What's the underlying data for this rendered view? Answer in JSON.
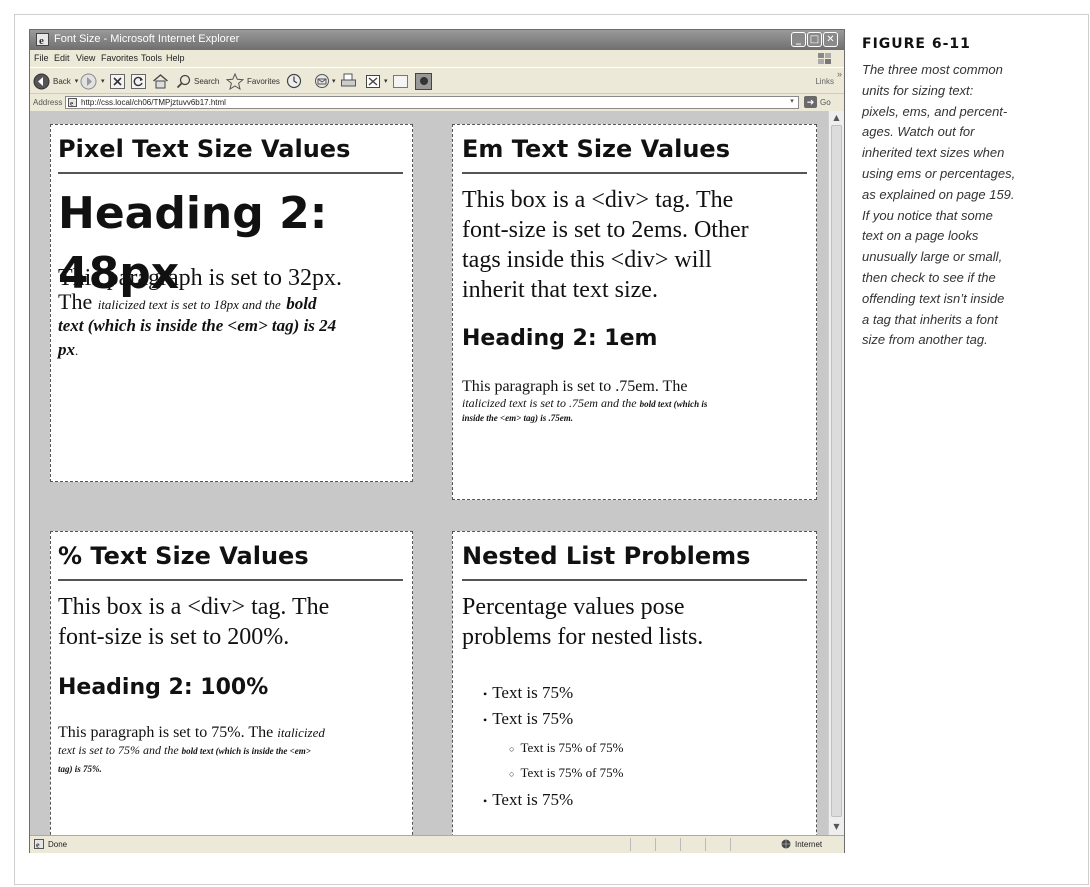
{
  "window": {
    "title": "Font Size - Microsoft Internet Explorer",
    "controls": [
      "minimize",
      "maximize",
      "close"
    ]
  },
  "menu": [
    "File",
    "Edit",
    "View",
    "Favorites",
    "Tools",
    "Help"
  ],
  "toolbar": {
    "back_label": "Back",
    "search_label": "Search",
    "favorites_label": "Favorites",
    "links_label": "Links",
    "icons": [
      "back-icon",
      "forward-icon",
      "stop-icon",
      "refresh-icon",
      "home-icon",
      "search-icon",
      "favorites-icon",
      "history-icon",
      "mail-icon",
      "print-icon",
      "edit-icon",
      "discuss-icon",
      "messenger-icon"
    ]
  },
  "address": {
    "label": "Address",
    "url": "http://css.local/ch06/TMPjztuvv6b17.html",
    "go_label": "Go"
  },
  "status": {
    "text": "Done",
    "zone": "Internet"
  },
  "boxes": {
    "pixel": {
      "title": "Pixel Text Size Values",
      "h2": "Heading 2: 48px",
      "p_line1": "This paragraph is set to 32px.",
      "p_the": "The",
      "p_italic": "italicized text is set to 18px and the",
      "p_bold_line1": "bold",
      "p_bold_line2": "text (which is inside the <em> tag) is 24",
      "p_bold_line3": "px",
      "p_period": "."
    },
    "em": {
      "title": "Em Text Size Values",
      "p_lines": [
        "This box is a <div> tag. The",
        "font-size is set to 2ems. Other",
        "tags inside this <div> will",
        "inherit that text size."
      ],
      "h2": "Heading 2: 1em",
      "small_line1": "This paragraph is set to .75em. The",
      "small_italic": "italicized text is set to .75em and the",
      "small_bold1": "bold text (which is",
      "small_bold2": "inside the <em> tag) is .75em."
    },
    "percent": {
      "title": "% Text Size Values",
      "p_lines": [
        "This box is a <div> tag. The",
        "font-size is set to 200%."
      ],
      "h2": "Heading 2: 100%",
      "small_line1": "This paragraph is set to 75%. The",
      "small_italic1": "italicized",
      "small_italic2": "text is set to 75% and the",
      "small_bold1": "bold text (which is inside the <em>",
      "small_bold2": "tag) is 75%."
    },
    "nested": {
      "title": "Nested List Problems",
      "p_lines": [
        "Percentage values pose",
        "problems for nested lists."
      ],
      "items": [
        "Text is 75%",
        "Text is 75%"
      ],
      "subitems": [
        "Text is 75% of 75%",
        "Text is 75% of 75%"
      ],
      "last_item": "Text is 75%"
    }
  },
  "caption": {
    "figure": "FIGURE 6-11",
    "lines": [
      "The three most common",
      "units for sizing text:",
      "pixels, ems, and percent-",
      "ages. Watch out for",
      "inherited text sizes when",
      "using ems or percentages,",
      "as explained on page 159.",
      "If you notice that some",
      "text on a page looks",
      "unusually large or small,",
      "then check to see if the",
      "offending text isn’t inside",
      "a tag that inherits a font",
      "size from another tag."
    ]
  }
}
